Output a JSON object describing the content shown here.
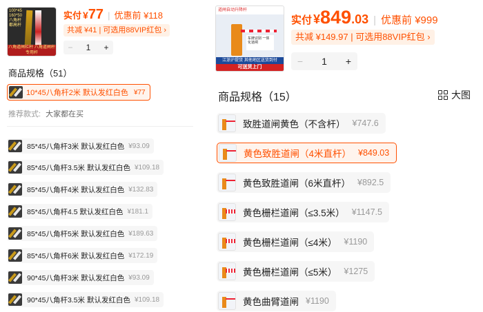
{
  "left": {
    "thumb": {
      "top_text": "100*45 160*50 八角杆 都高杆",
      "caption": "八角道闸栏杆 八角道闸杆 专用杆"
    },
    "price": {
      "label": "实付",
      "currency": "¥",
      "amount": "77",
      "original": "优惠前 ¥118"
    },
    "promo": {
      "text": "共减 ¥41 | 可选用88VIP红包 ›"
    },
    "stepper": {
      "minus": "−",
      "quantity": "1",
      "plus": "+"
    },
    "spec_title": "商品规格（51）",
    "selected": {
      "name": "10*45八角杆2米 默认发红白色",
      "price": "¥77"
    },
    "recommend": {
      "label": "推荐款式:",
      "value": "大家都在买"
    },
    "options": [
      {
        "name": "85*45八角杆3米 默认发红白色",
        "price": "¥93.09"
      },
      {
        "name": "85*45八角杆3.5米 默认发红白色",
        "price": "¥109.18"
      },
      {
        "name": "85*45八角杆4米 默认发红白色",
        "price": "¥132.83"
      },
      {
        "name": "85*45八角杆4.5 默认发红白色",
        "price": "¥181.1"
      },
      {
        "name": "85*45八角杆5米 默认发红白色",
        "price": "¥189.63"
      },
      {
        "name": "85*45八角杆6米 默认发红白色",
        "price": "¥172.19"
      },
      {
        "name": "90*45八角杆3米 默认发红白色",
        "price": "¥93.09"
      },
      {
        "name": "90*45八角杆3.5米 默认发红白色",
        "price": "¥109.18"
      }
    ]
  },
  "right": {
    "thumb": {
      "top_text": "道闸自动升降杆",
      "panel_text": "车牌识别 一体化道闸",
      "foot": "江浙沪提货 其他地区送货到付",
      "foot2": "可送货上门"
    },
    "price": {
      "label": "实付",
      "currency": "¥",
      "amount": "849",
      "decimal": ".03",
      "original": "优惠前 ¥999"
    },
    "promo": {
      "text": "共减 ¥149.97 | 可选用88VIP红包 ›"
    },
    "stepper": {
      "minus": "−",
      "quantity": "1",
      "plus": "+"
    },
    "spec_title": "商品规格（15）",
    "view_label": "大图",
    "options": [
      {
        "name": "致胜道闸黄色（不含杆）",
        "price": "¥747.6"
      },
      {
        "name": "黄色致胜道闸（4米直杆）",
        "price": "¥849.03"
      },
      {
        "name": "黄色致胜道闸（6米直杆）",
        "price": "¥892.5"
      },
      {
        "name": "黄色栅栏道闸（≤3.5米）",
        "price": "¥1147.5"
      },
      {
        "name": "黄色栅栏道闸（≤4米）",
        "price": "¥1190"
      },
      {
        "name": "黄色栅栏道闸（≤5米）",
        "price": "¥1275"
      },
      {
        "name": "黄色曲臂道闸",
        "price": "¥1190"
      }
    ]
  },
  "colors": {
    "accent": "#ff5000",
    "chip_bg": "#f6f6f6",
    "selected_bg": "#fff4ed",
    "muted": "#999999"
  }
}
